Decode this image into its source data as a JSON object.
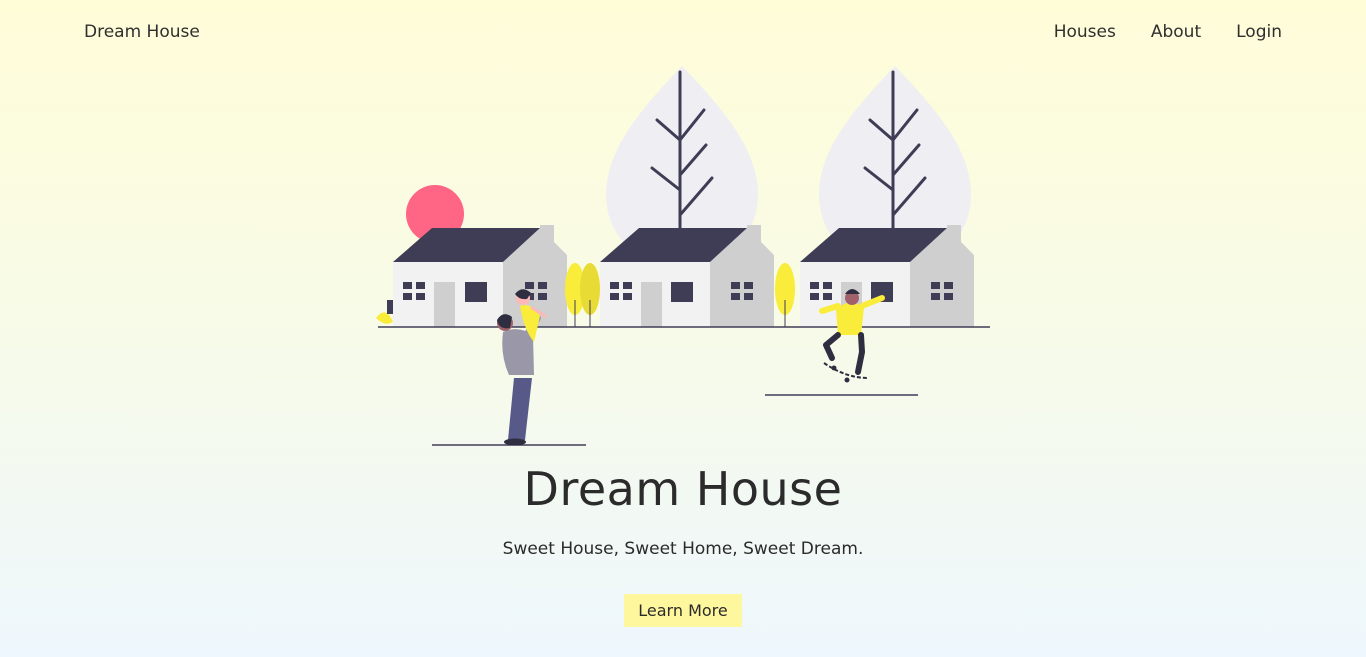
{
  "navbar": {
    "brand": "Dream House",
    "links": [
      "Houses",
      "About",
      "Login"
    ]
  },
  "hero": {
    "title": "Dream House",
    "subtitle": "Sweet House, Sweet Home, Sweet Dream.",
    "cta_label": "Learn More"
  },
  "colors": {
    "accent_yellow": "#fff79e",
    "sun_pink": "#ff6584",
    "roof_dark": "#3f3d56",
    "illustration_yellow": "#f9ec3a"
  },
  "icons": {
    "illustration": "houses-family-skater-illustration"
  }
}
